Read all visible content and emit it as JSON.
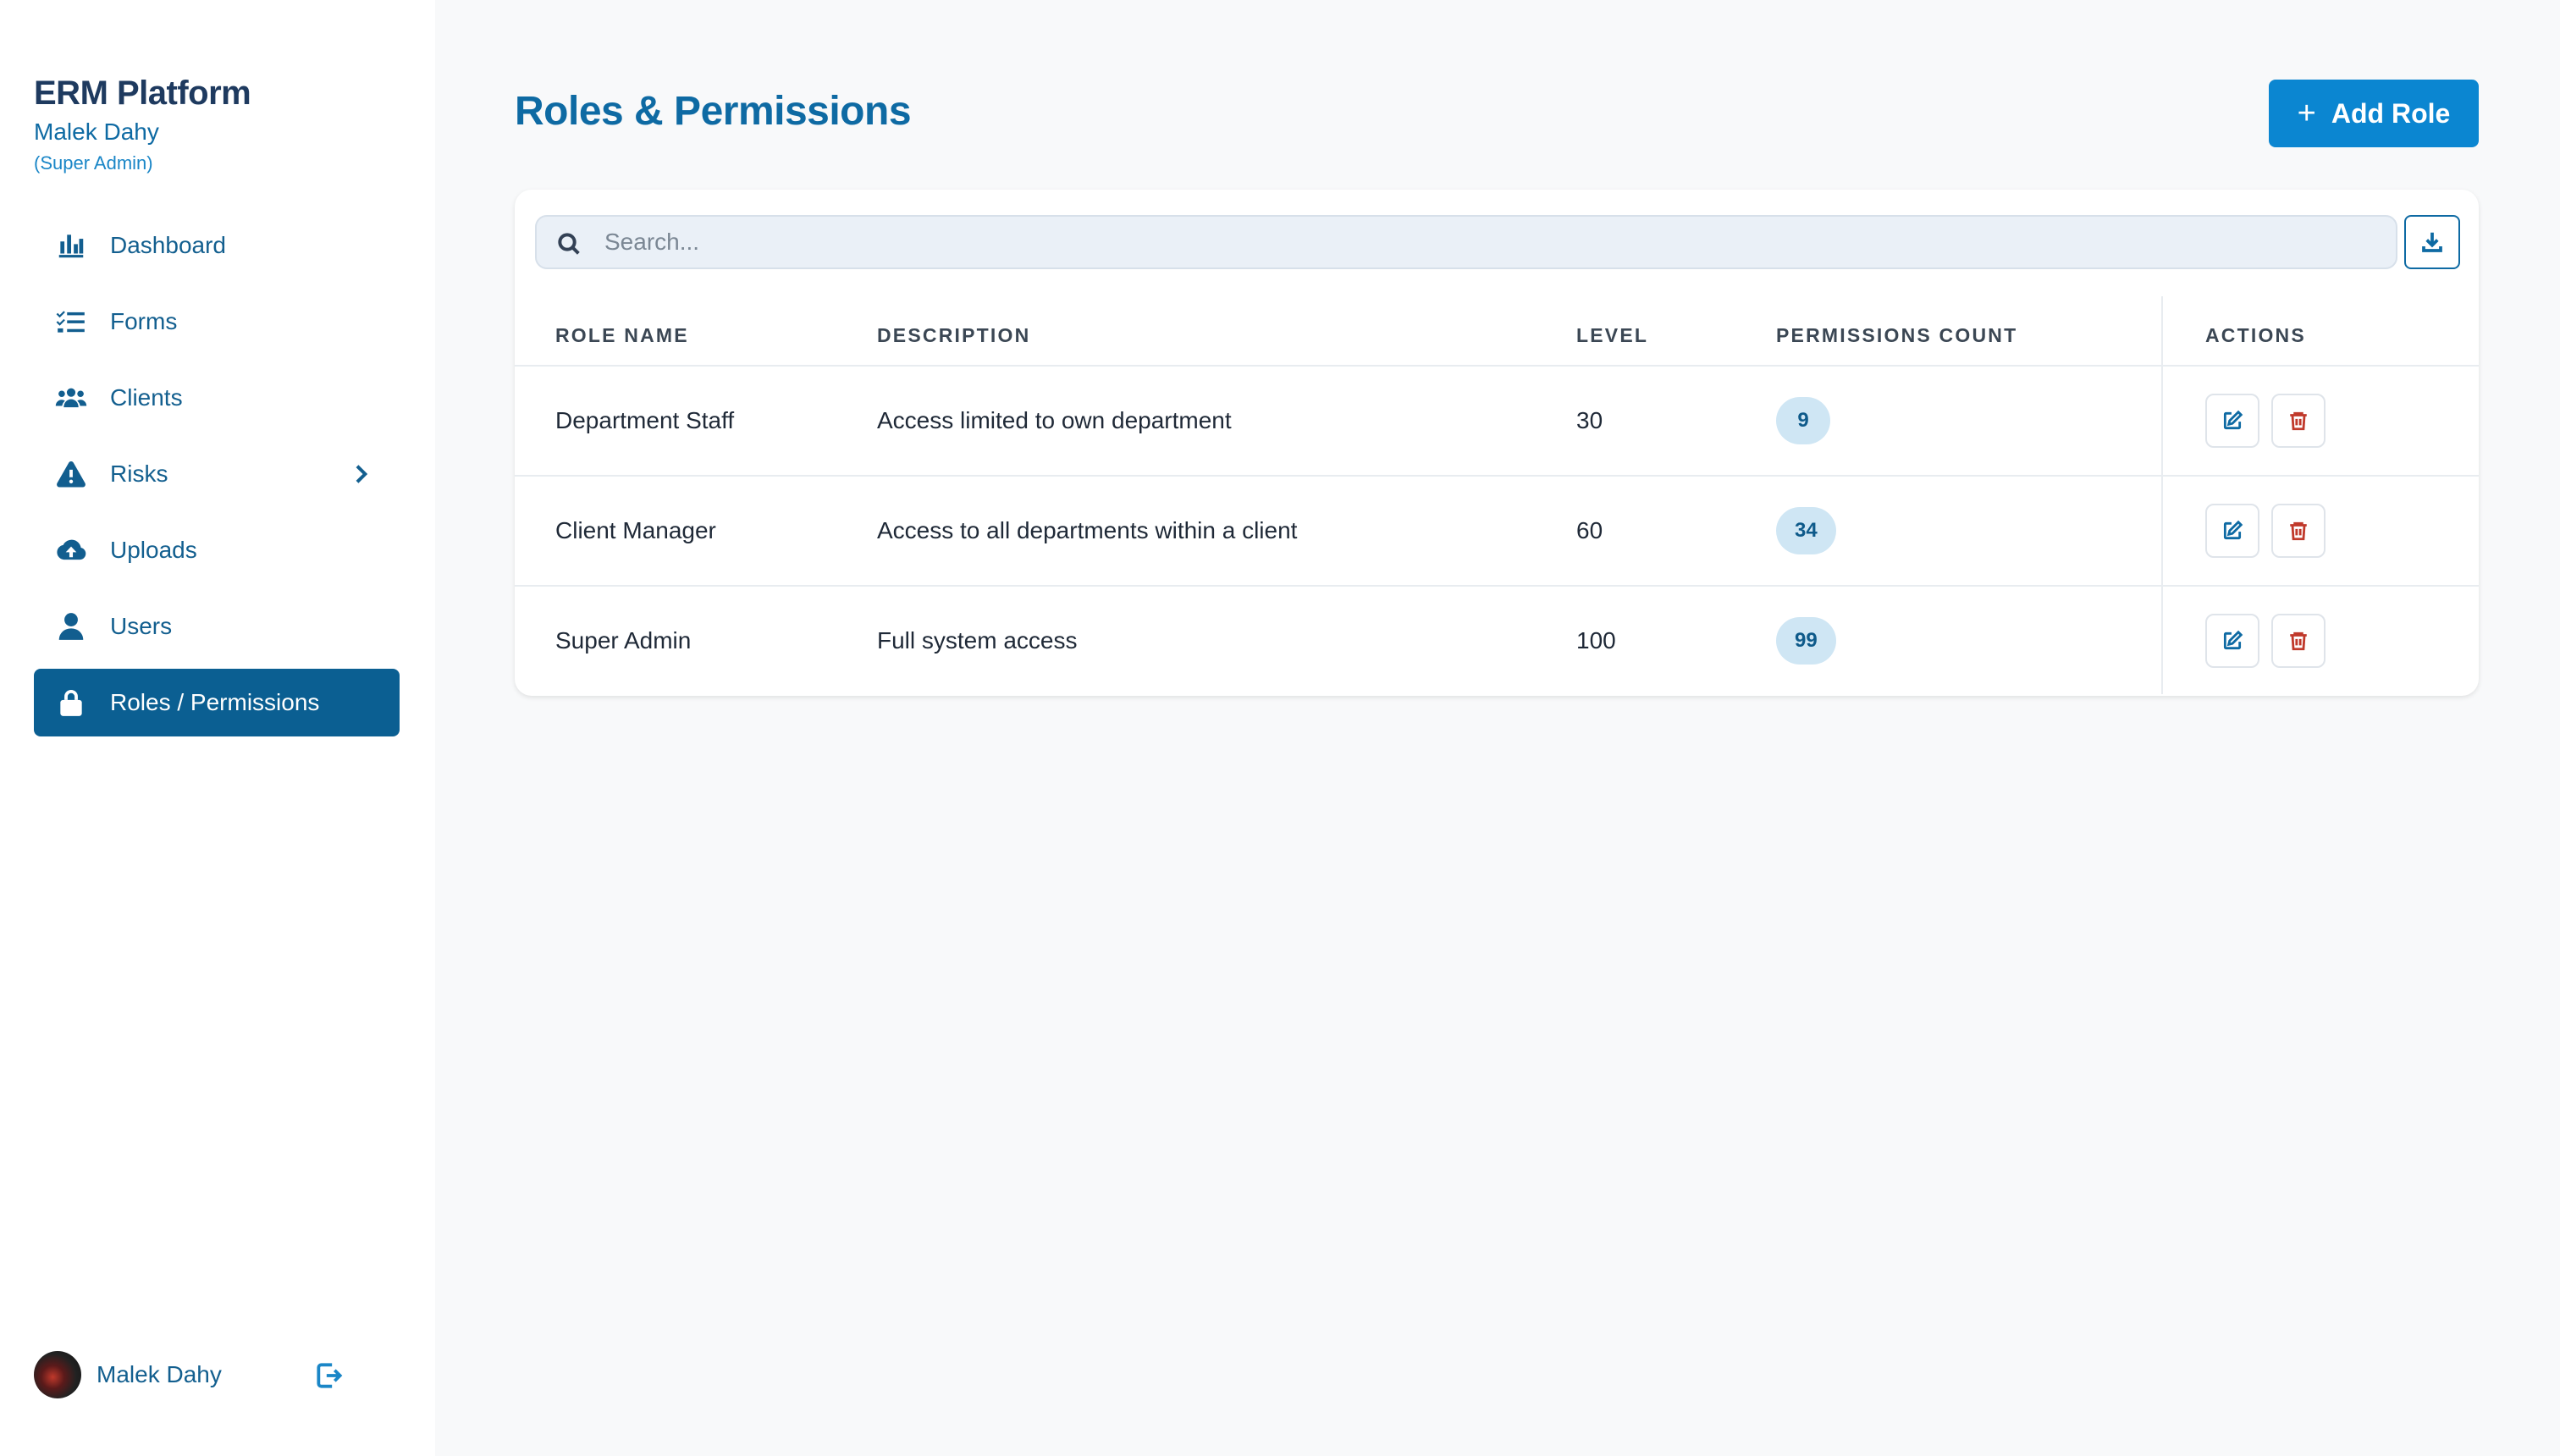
{
  "sidebar": {
    "brand": "ERM Platform",
    "user_name": "Malek Dahy",
    "user_role": "(Super Admin)",
    "items": [
      {
        "label": "Dashboard",
        "icon": "bar-chart-icon"
      },
      {
        "label": "Forms",
        "icon": "checklist-icon"
      },
      {
        "label": "Clients",
        "icon": "users-group-icon"
      },
      {
        "label": "Risks",
        "icon": "warning-icon",
        "has_submenu": true
      },
      {
        "label": "Uploads",
        "icon": "cloud-upload-icon"
      },
      {
        "label": "Users",
        "icon": "user-icon"
      },
      {
        "label": "Roles / Permissions",
        "icon": "lock-icon",
        "active": true
      }
    ],
    "footer": {
      "name": "Malek Dahy"
    }
  },
  "main": {
    "title": "Roles & Permissions",
    "add_button_label": "Add Role",
    "search_placeholder": "Search...",
    "columns": [
      "ROLE NAME",
      "DESCRIPTION",
      "LEVEL",
      "PERMISSIONS COUNT",
      "ACTIONS"
    ],
    "rows": [
      {
        "name": "Department Staff",
        "description": "Access limited to own department",
        "level": "30",
        "permissions": "9"
      },
      {
        "name": "Client Manager",
        "description": "Access to all departments within a client",
        "level": "60",
        "permissions": "34"
      },
      {
        "name": "Super Admin",
        "description": "Full system access",
        "level": "100",
        "permissions": "99"
      }
    ]
  },
  "colors": {
    "primary": "#0b86d1",
    "sidebar_active": "#0b5f92",
    "title": "#0e6aa3",
    "badge_bg": "#cfe6f4",
    "delete": "#c0392b"
  }
}
